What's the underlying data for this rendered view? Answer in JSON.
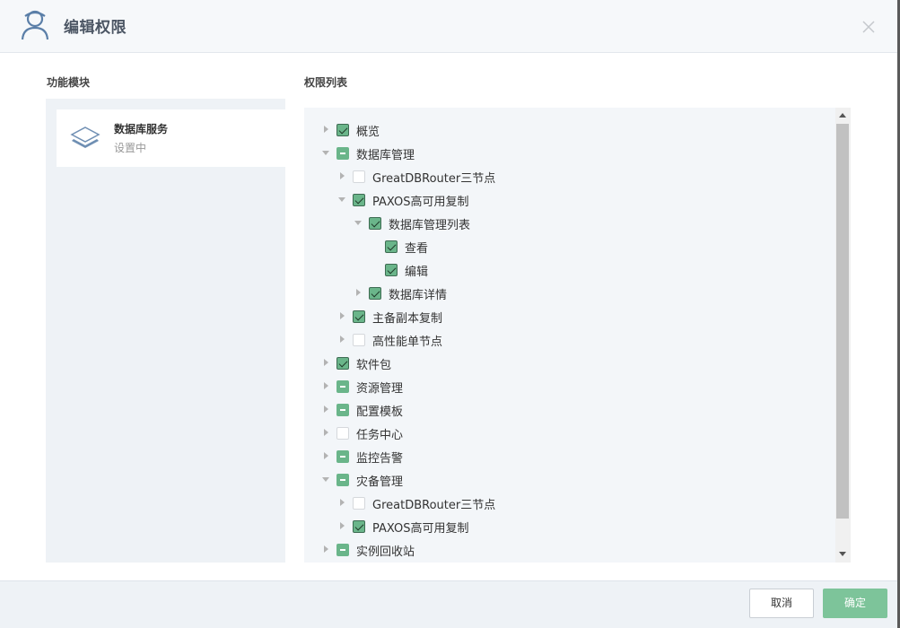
{
  "dialog": {
    "title": "编辑权限",
    "close_icon": "close-icon",
    "user_icon": "user-icon"
  },
  "modules": {
    "label": "功能模块",
    "items": [
      {
        "name": "数据库服务",
        "status": "设置中",
        "icon": "layers-icon"
      }
    ]
  },
  "permissions": {
    "label": "权限列表",
    "rows": [
      {
        "label": "概览",
        "depth": 0,
        "arrow": "collapsed",
        "check": "checked"
      },
      {
        "label": "数据库管理",
        "depth": 0,
        "arrow": "expanded",
        "check": "partial"
      },
      {
        "label": "GreatDBRouter三节点",
        "depth": 1,
        "arrow": "collapsed",
        "check": "unchecked"
      },
      {
        "label": "PAXOS高可用复制",
        "depth": 1,
        "arrow": "expanded",
        "check": "checked"
      },
      {
        "label": "数据库管理列表",
        "depth": 2,
        "arrow": "expanded",
        "check": "checked"
      },
      {
        "label": "查看",
        "depth": 3,
        "arrow": "none",
        "check": "checked"
      },
      {
        "label": "编辑",
        "depth": 3,
        "arrow": "none",
        "check": "checked"
      },
      {
        "label": "数据库详情",
        "depth": 2,
        "arrow": "collapsed",
        "check": "checked"
      },
      {
        "label": "主备副本复制",
        "depth": 1,
        "arrow": "collapsed",
        "check": "checked"
      },
      {
        "label": "高性能单节点",
        "depth": 1,
        "arrow": "collapsed",
        "check": "unchecked"
      },
      {
        "label": "软件包",
        "depth": 0,
        "arrow": "collapsed",
        "check": "checked"
      },
      {
        "label": "资源管理",
        "depth": 0,
        "arrow": "collapsed",
        "check": "partial"
      },
      {
        "label": "配置模板",
        "depth": 0,
        "arrow": "collapsed",
        "check": "partial"
      },
      {
        "label": "任务中心",
        "depth": 0,
        "arrow": "collapsed",
        "check": "unchecked"
      },
      {
        "label": "监控告警",
        "depth": 0,
        "arrow": "collapsed",
        "check": "partial"
      },
      {
        "label": "灾备管理",
        "depth": 0,
        "arrow": "expanded",
        "check": "partial"
      },
      {
        "label": "GreatDBRouter三节点",
        "depth": 1,
        "arrow": "collapsed",
        "check": "unchecked"
      },
      {
        "label": "PAXOS高可用复制",
        "depth": 1,
        "arrow": "collapsed",
        "check": "checked"
      },
      {
        "label": "实例回收站",
        "depth": 0,
        "arrow": "collapsed",
        "check": "partial"
      }
    ]
  },
  "footer": {
    "cancel_label": "取消",
    "confirm_label": "确定"
  },
  "colors": {
    "accent": "#6ab58a",
    "confirm_button": "#7dc49a",
    "panel_bg": "#eef2f6"
  }
}
